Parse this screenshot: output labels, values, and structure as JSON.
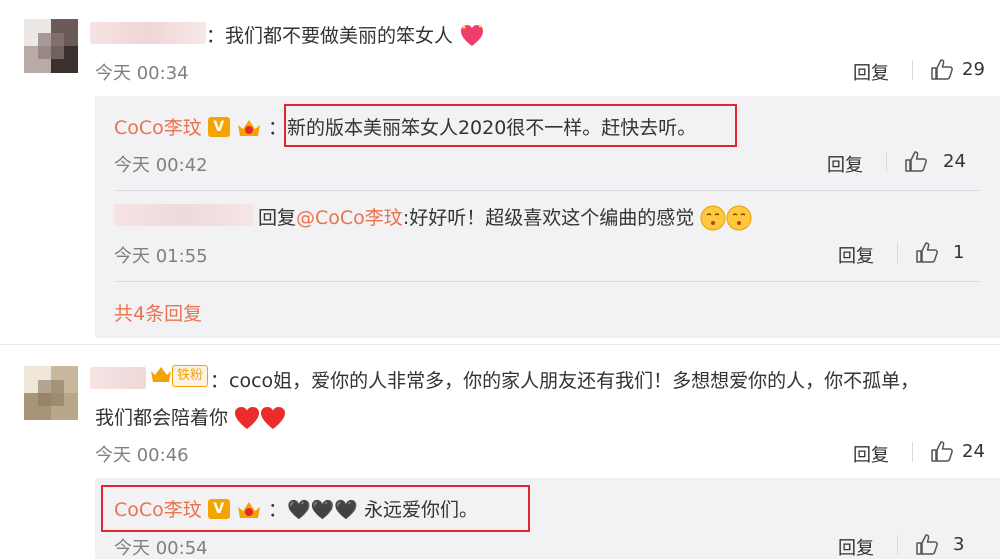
{
  "comments": [
    {
      "text": "：我们都不要做美丽的笨女人",
      "time": "今天 00:34",
      "reply_label": "回复",
      "likes": "29",
      "replies": [
        {
          "author": "CoCo李玟",
          "text": "：新的版本美丽笨女人2020很不一样。赶快去听。",
          "time": "今天 00:42",
          "reply_label": "回复",
          "likes": "24"
        },
        {
          "prefix": "回复",
          "mention": "@CoCo李玟",
          "text": ":好好听！超级喜欢这个编曲的感觉",
          "time": "今天 01:55",
          "reply_label": "回复",
          "likes": "1"
        }
      ],
      "more_replies": "共4条回复"
    },
    {
      "badge": "铁粉",
      "text_line1": "：coco姐，爱你的人非常多，你的家人朋友还有我们！多想想爱你的人，你不孤单，",
      "text_line2": "我们都会陪着你",
      "time": "今天 00:46",
      "reply_label": "回复",
      "likes": "24",
      "replies": [
        {
          "author": "CoCo李玟",
          "text": "：🖤🖤🖤 永远爱你们。",
          "time": "今天 00:54",
          "reply_label": "回复",
          "likes": "3"
        }
      ]
    }
  ],
  "icons": {
    "thumb": "thumbs-up-icon",
    "heart": "heart-icon",
    "crown": "crown-icon",
    "vip": "verified-v-icon",
    "kiss": "kiss-face-icon"
  },
  "colors": {
    "accent": "#eb7350",
    "panel": "#f2f2f5",
    "highlight_border": "#e0262f",
    "badge": "#f5a300"
  }
}
